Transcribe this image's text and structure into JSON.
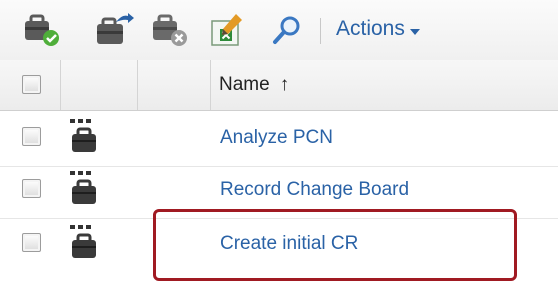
{
  "toolbar": {
    "icons": [
      "add-task-icon",
      "move-task-icon",
      "remove-task-icon",
      "export-excel-icon",
      "search-icon"
    ],
    "actions_label": "Actions"
  },
  "table": {
    "columns": [
      "",
      "",
      "",
      "Name"
    ],
    "sort_indicator": "↑",
    "rows": [
      {
        "name": "Analyze PCN",
        "type_icon": "workflow-task-icon"
      },
      {
        "name": "Record Change Board",
        "type_icon": "workflow-task-icon"
      },
      {
        "name": "Create initial CR",
        "type_icon": "workflow-task-icon"
      }
    ]
  },
  "highlight": {
    "target_row": "Create initial CR",
    "color": "#a01a22"
  },
  "colors": {
    "link": "#2a62a6",
    "toolbar_bg": "#f4f4f4"
  }
}
